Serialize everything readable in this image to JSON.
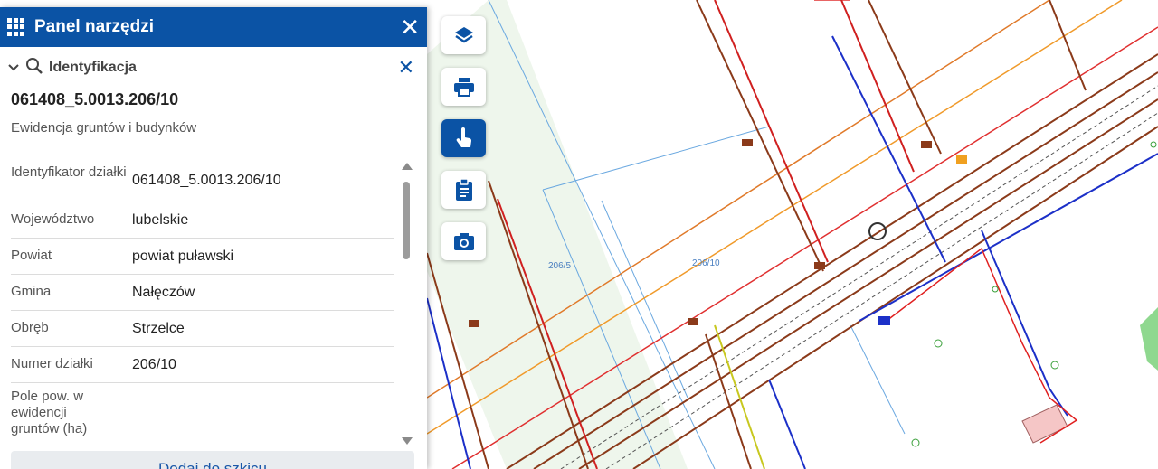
{
  "panel": {
    "title": "Panel narzędzi",
    "section_title": "Identyfikacja",
    "parcel_id": "061408_5.0013.206/10",
    "subtitle": "Ewidencja gruntów i budynków",
    "rows": [
      {
        "label": "Identyfikator działki",
        "value": "061408_5.0013.206/10"
      },
      {
        "label": "Województwo",
        "value": "lubelskie"
      },
      {
        "label": "Powiat",
        "value": "powiat puławski"
      },
      {
        "label": "Gmina",
        "value": "Nałęczów"
      },
      {
        "label": "Obręb",
        "value": "Strzelce"
      },
      {
        "label": "Numer działki",
        "value": "206/10"
      },
      {
        "label": "Pole pow. w ewidencji gruntów (ha)",
        "value": ""
      }
    ],
    "add_button": "Dodaj do szkicu"
  },
  "toolbar": {
    "items": [
      {
        "name": "layers-button",
        "icon": "layers-icon"
      },
      {
        "name": "print-button",
        "icon": "printer-icon"
      },
      {
        "name": "identify-button",
        "icon": "pointer-hand-icon",
        "active": true
      },
      {
        "name": "clipboard-button",
        "icon": "clipboard-icon"
      },
      {
        "name": "screenshot-button",
        "icon": "camera-icon"
      }
    ]
  },
  "map": {
    "parcel_labels": [
      "206/5",
      "206/10"
    ]
  },
  "colors": {
    "primary": "#0b53a5",
    "panel_bg": "#ffffff",
    "map_bg": "#f4f4f0"
  }
}
